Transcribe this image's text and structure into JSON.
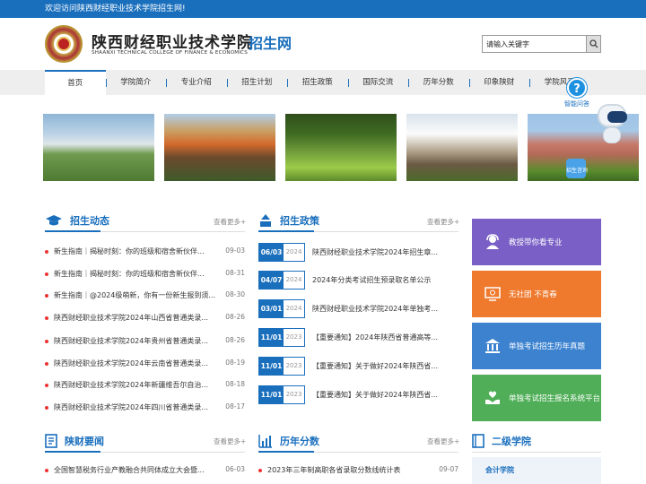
{
  "topbar": {
    "welcome": "欢迎访问陕西财经职业技术学院招生网!"
  },
  "header": {
    "logo_cn": "陕西财经职业技术学院",
    "logo_en": "SHAANXI TECHNICAL COLLEGE OF FINANCE & ECONOMICS",
    "logo_sub": "招生网",
    "search_placeholder": "请输入关键字"
  },
  "nav": {
    "items": [
      "首页",
      "学院简介",
      "专业介绍",
      "招生计划",
      "招生政策",
      "国际交流",
      "历年分数",
      "印象陕财",
      "学院风采"
    ]
  },
  "float": {
    "qa_label": "智能问答",
    "bottom_label": "招生咨询"
  },
  "admissions_news": {
    "title": "招生动态",
    "more": "查看更多+",
    "items": [
      {
        "text": "新生指南｜揭秘时刻：你的班级和宿舍新伙伴...",
        "date": "09-03"
      },
      {
        "text": "新生指南｜揭秘时刻：你的班级和宿舍新伙伴...",
        "date": "08-31"
      },
      {
        "text": "新生指南｜@2024级萌新，你有一份新生报到须...",
        "date": "08-30"
      },
      {
        "text": "陕西财经职业技术学院2024年山西省普通类录...",
        "date": "08-26"
      },
      {
        "text": "陕西财经职业技术学院2024年贵州省普通类录...",
        "date": "08-26"
      },
      {
        "text": "陕西财经职业技术学院2024年云南省普通类录...",
        "date": "08-19"
      },
      {
        "text": "陕西财经职业技术学院2024年新疆维吾尔自治...",
        "date": "08-18"
      },
      {
        "text": "陕西财经职业技术学院2024年四川省普通类录...",
        "date": "08-17"
      }
    ]
  },
  "policy": {
    "title": "招生政策",
    "more": "查看更多+",
    "items": [
      {
        "day": "06/03",
        "year": "2024",
        "text": "陕西财经职业技术学院2024年招生章..."
      },
      {
        "day": "04/07",
        "year": "2024",
        "text": "2024年分类考试招生预录取名单公示"
      },
      {
        "day": "03/01",
        "year": "2024",
        "text": "陕西财经职业技术学院2024年单独考..."
      },
      {
        "day": "11/01",
        "year": "2023",
        "text": "【重要通知】2024年陕西省普通高等..."
      },
      {
        "day": "11/01",
        "year": "2023",
        "text": "【重要通知】关于做好2024年陕西省..."
      },
      {
        "day": "11/01",
        "year": "2023",
        "text": "【重要通知】关于做好2024年陕西省..."
      }
    ]
  },
  "cards": [
    {
      "label": "教授带你看专业",
      "color": "#7a5fc6",
      "icon": "user-headset-icon"
    },
    {
      "label": "无社团 不青春",
      "color": "#ef7a2e",
      "icon": "screen-icon"
    },
    {
      "label": "单独考试招生历年真题",
      "color": "#3c82cf",
      "icon": "building-icon"
    },
    {
      "label": "单独考试招生报名系统平台",
      "color": "#4fae57",
      "icon": "hands-heart-icon"
    }
  ],
  "news": {
    "title": "陕财要闻",
    "more": "查看更多+",
    "items": [
      {
        "text": "全国智慧税务行业产教融合共同体成立大会暨...",
        "date": "06-03"
      }
    ]
  },
  "scores": {
    "title": "历年分数",
    "more": "查看更多+",
    "items": [
      {
        "text": "2023年三年制高职各省录取分数线统计表",
        "date": "09-07"
      }
    ]
  },
  "schools": {
    "title": "二级学院",
    "items": [
      "会计学院"
    ]
  }
}
